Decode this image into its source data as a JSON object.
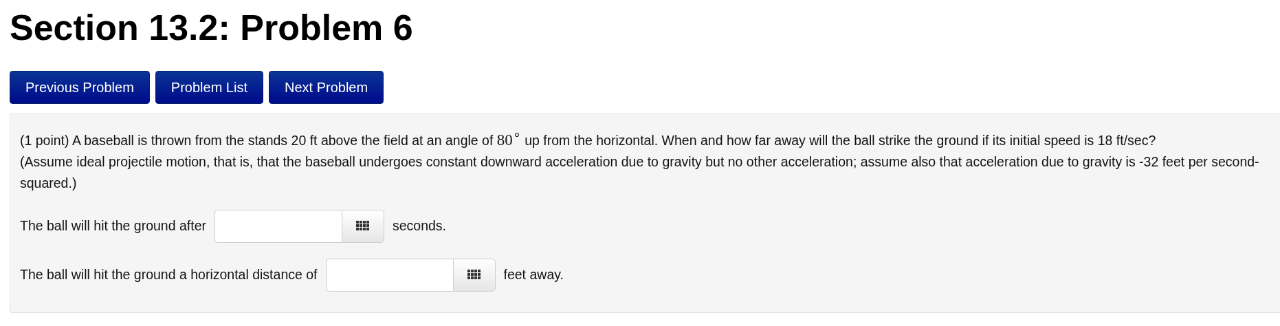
{
  "title": "Section 13.2: Problem 6",
  "nav_buttons": [
    "Previous Problem",
    "Problem List",
    "Next Problem"
  ],
  "problem": {
    "intro": {
      "before": "(1 point) A baseball is thrown from the stands 20 ft above the field at an angle of ",
      "math": "80$^{∘}$",
      "after": " up from the horizontal. When and how far away will the ball strike the ground if its initial speed is 18 ft/sec?"
    },
    "note": "(Assume ideal projectile motion, that is, that the baseball undergoes constant downward acceleration due to gravity but no other acceleration; assume also that acceleration due to gravity is -32 feet per second-squared.)",
    "answers": [
      {
        "label": "The ball will hit the ground after",
        "unit": "seconds."
      },
      {
        "label": "The ball will hit the ground a horizontal distance of",
        "unit": "feet away."
      }
    ]
  }
}
